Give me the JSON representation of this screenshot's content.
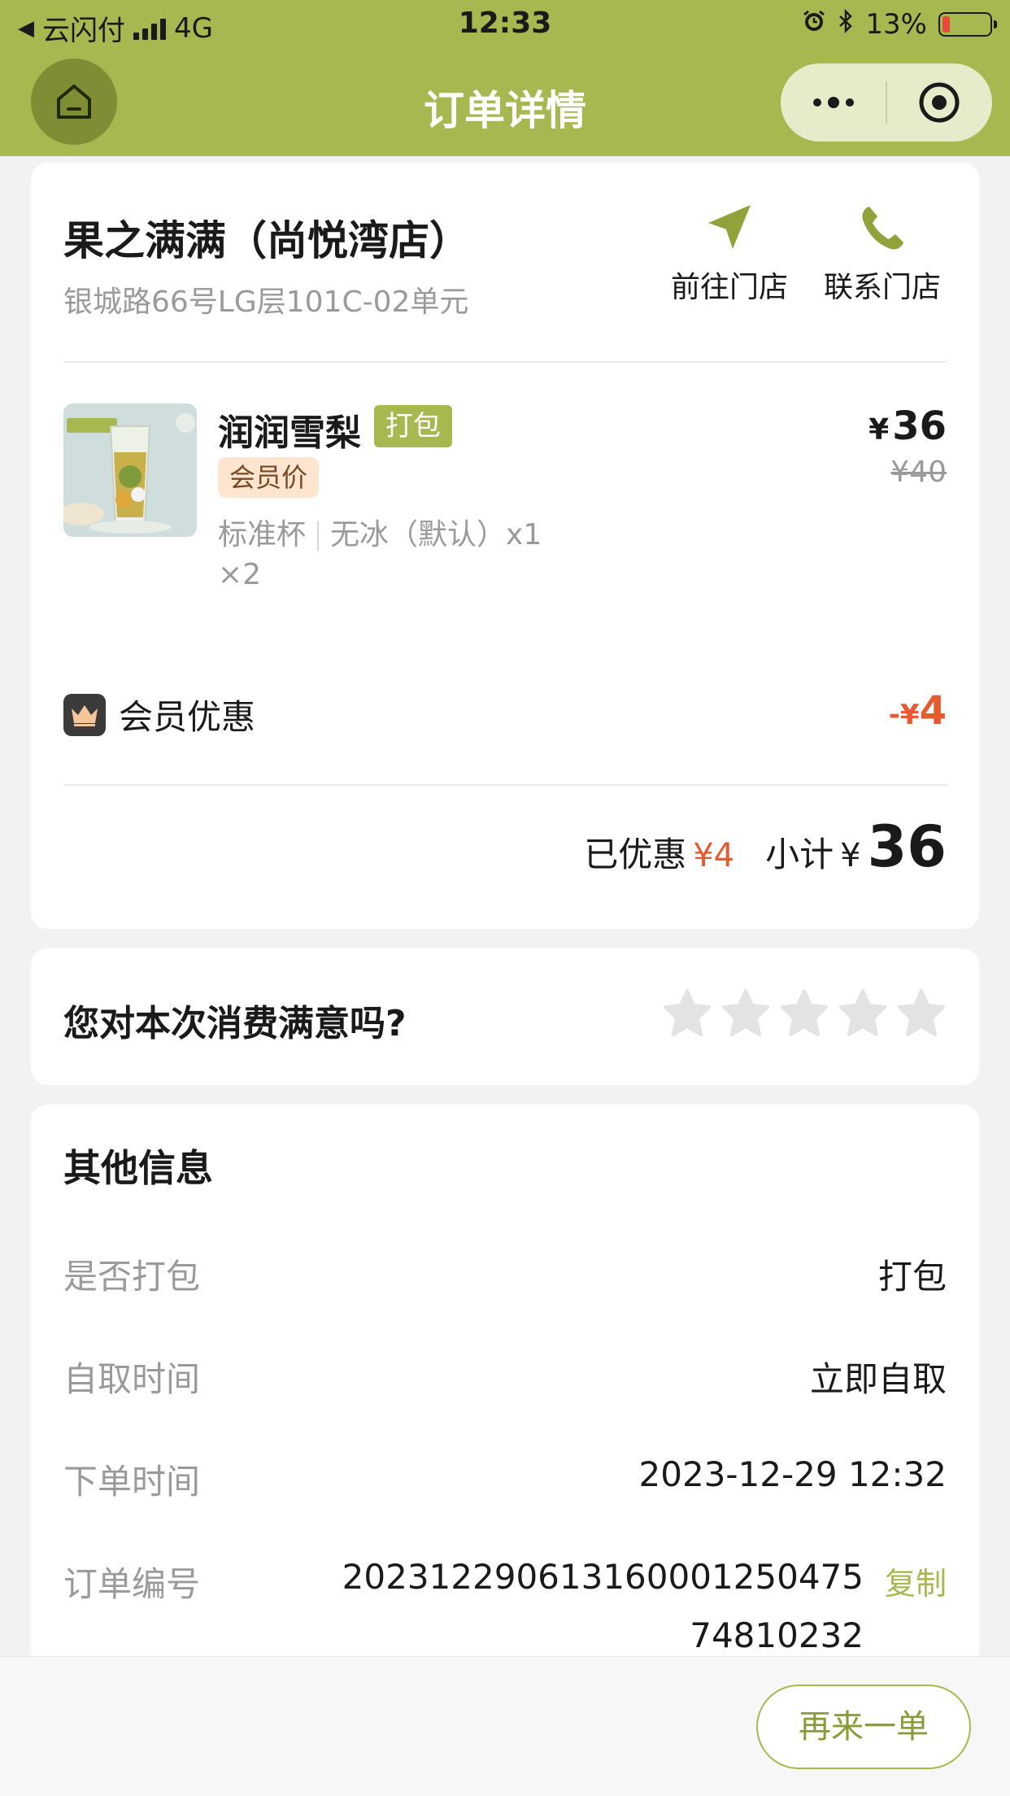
{
  "status_bar": {
    "back_app": "云闪付",
    "network": "4G",
    "time": "12:33",
    "battery": "13%"
  },
  "nav": {
    "title": "订单详情"
  },
  "store": {
    "name": "果之满满（尚悦湾店）",
    "address": "银城路66号LG层101C-02单元",
    "navigate_label": "前往门店",
    "call_label": "联系门店"
  },
  "item": {
    "name": "润润雪梨",
    "pack_tag": "打包",
    "member_tag": "会员价",
    "spec_size": "标准杯",
    "spec_ice": "无冰（默认）x1",
    "quantity": "×2",
    "price_currency": "¥",
    "price": "36",
    "original_price": "¥40"
  },
  "discount": {
    "label": "会员优惠",
    "amount_prefix": "-",
    "currency": "¥",
    "amount": "4"
  },
  "summary": {
    "saved_label": "已优惠",
    "saved_amount": "¥4",
    "subtotal_label": "小计",
    "currency": "¥",
    "subtotal": "36"
  },
  "rating": {
    "question": "您对本次消费满意吗?",
    "max_stars": 5,
    "selected_stars": 0
  },
  "other_info": {
    "title": "其他信息",
    "rows": [
      {
        "label": "是否打包",
        "value": "打包"
      },
      {
        "label": "自取时间",
        "value": "立即自取"
      },
      {
        "label": "下单时间",
        "value": "2023-12-29 12:32"
      },
      {
        "label": "订单编号",
        "value": "2023122906131600012504​75",
        "value_line2": "74810232"
      }
    ],
    "copy_label": "复制"
  },
  "bottom": {
    "reorder_label": "再来一单"
  },
  "colors": {
    "brand": "#a6b84f",
    "discount": "#e55a2f"
  }
}
